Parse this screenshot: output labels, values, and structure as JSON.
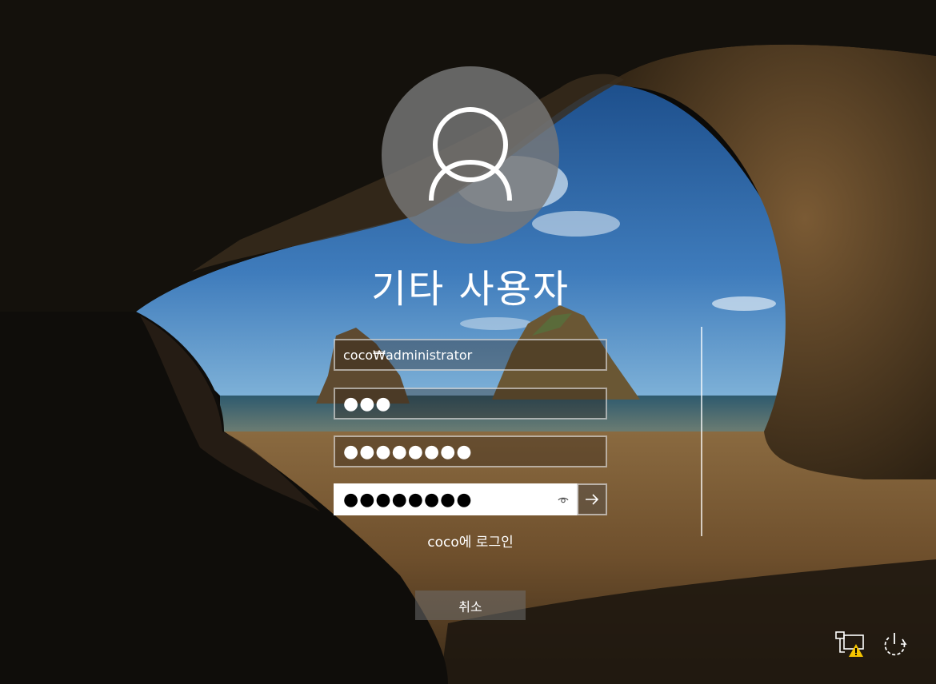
{
  "login": {
    "user_display_name": "기타 사용자",
    "username_value": "coco₩administrator",
    "password_masked": "●●●",
    "new_password_masked": "●●●●●●●●",
    "confirm_password_masked": "●●●●●●●●",
    "sign_in_to": "coco에 로그인",
    "cancel_label": "취소"
  },
  "system_icons": [
    "network-warning-icon",
    "power-icon"
  ],
  "colors": {
    "field_border": "#c8c8c8",
    "active_field_bg": "#ffffff",
    "warning": "#f5c400"
  }
}
